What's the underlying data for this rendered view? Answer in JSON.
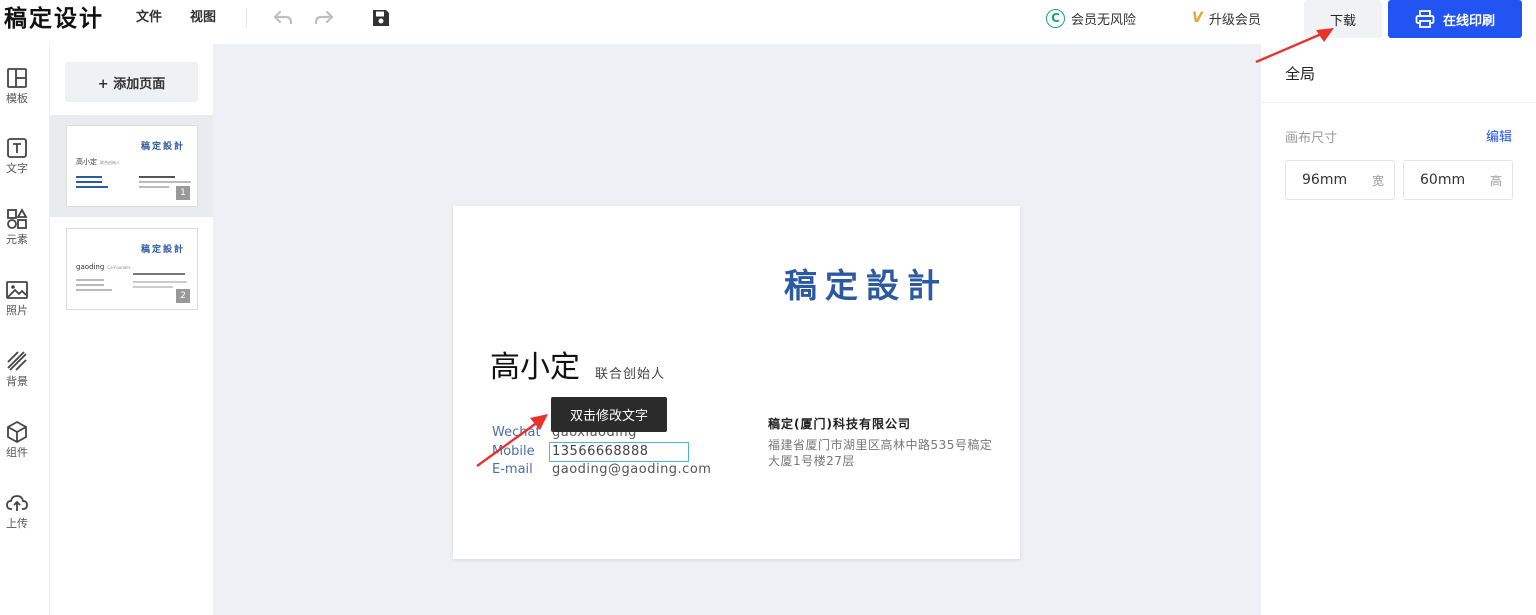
{
  "app": {
    "logo": "稿定设计"
  },
  "menu": {
    "file": "文件",
    "view": "视图"
  },
  "header": {
    "safe_label": "会员无风险",
    "safe_icon_glyph": "C",
    "vip_label": "升级会员",
    "vip_icon_glyph": "V",
    "download_label": "下载",
    "print_label": "在线印刷"
  },
  "rail": [
    {
      "label": "模板",
      "icon": "template-icon"
    },
    {
      "label": "文字",
      "icon": "text-icon"
    },
    {
      "label": "元素",
      "icon": "elements-icon"
    },
    {
      "label": "照片",
      "icon": "photo-icon"
    },
    {
      "label": "背景",
      "icon": "background-icon"
    },
    {
      "label": "组件",
      "icon": "component-icon"
    },
    {
      "label": "上传",
      "icon": "upload-icon"
    }
  ],
  "pages": {
    "add_label": "+ 添加页面",
    "items": [
      {
        "number": "1",
        "brand": "稿定設計",
        "name": "高小定",
        "title": "联合创始人"
      },
      {
        "number": "2",
        "brand": "稿定設計",
        "name": "gaoding",
        "title": "Co-Founder"
      }
    ]
  },
  "card": {
    "brand": "稿定設計",
    "name": "高小定",
    "title": "联合创始人",
    "contacts": [
      {
        "label": "Wechat",
        "value": "gaoxiaoding"
      },
      {
        "label": "Mobile",
        "value": "13566668888"
      },
      {
        "label": "E-mail",
        "value": "gaoding@gaoding.com"
      }
    ],
    "company": "稿定(厦门)科技有限公司",
    "address": "福建省厦门市湖里区高林中路535号稿定大厦1号楼27层"
  },
  "tooltip": "双击修改文字",
  "right_panel": {
    "title": "全局",
    "canvas_size_label": "画布尺寸",
    "edit_label": "编辑",
    "width_value": "96mm",
    "width_unit": "宽",
    "height_value": "60mm",
    "height_unit": "高"
  },
  "colors": {
    "accent": "#2254f4",
    "brand_blue": "#2c5aa0",
    "annotation_red": "#e8322b"
  }
}
